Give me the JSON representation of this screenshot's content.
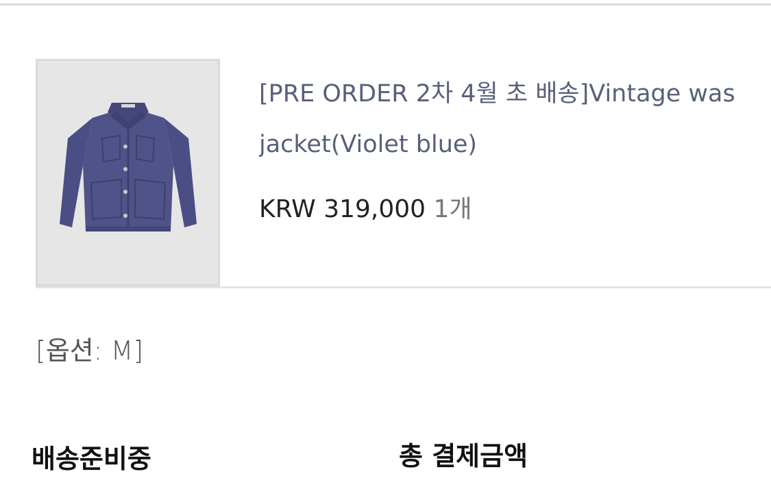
{
  "order_item": {
    "product_name_line1": "[PRE ORDER 2차 4월 초 배송]Vintage was",
    "product_name_line2": "jacket(Violet blue)",
    "currency": "KRW",
    "price": "319,000",
    "quantity": "1개",
    "image_icon": "jacket-product-image",
    "jacket_color": "#4b4f86"
  },
  "option": {
    "text": "[옵션: M]"
  },
  "summary": {
    "status_label": "배송준비중",
    "total_label": "총 결제금액"
  }
}
